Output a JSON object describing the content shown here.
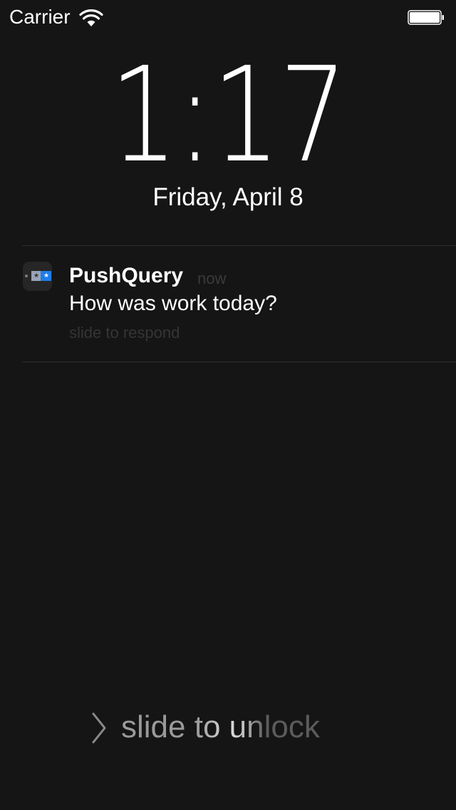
{
  "status_bar": {
    "carrier": "Carrier",
    "wifi_icon": "wifi-icon",
    "battery_icon": "battery-full-icon",
    "battery_level": 1.0
  },
  "lock_screen": {
    "time": "1:17",
    "date": "Friday, April 8"
  },
  "notification": {
    "app_icon": "pushquery-app-icon",
    "app_name": "PushQuery",
    "timestamp": "now",
    "message": "How was work today?",
    "action_hint": "slide to respond"
  },
  "unlock": {
    "chevron_icon": "chevron-right-icon",
    "label": "slide to unlock"
  },
  "colors": {
    "background": "#151515",
    "text": "#ffffff",
    "app_icon_accent": "#1e7de8"
  }
}
